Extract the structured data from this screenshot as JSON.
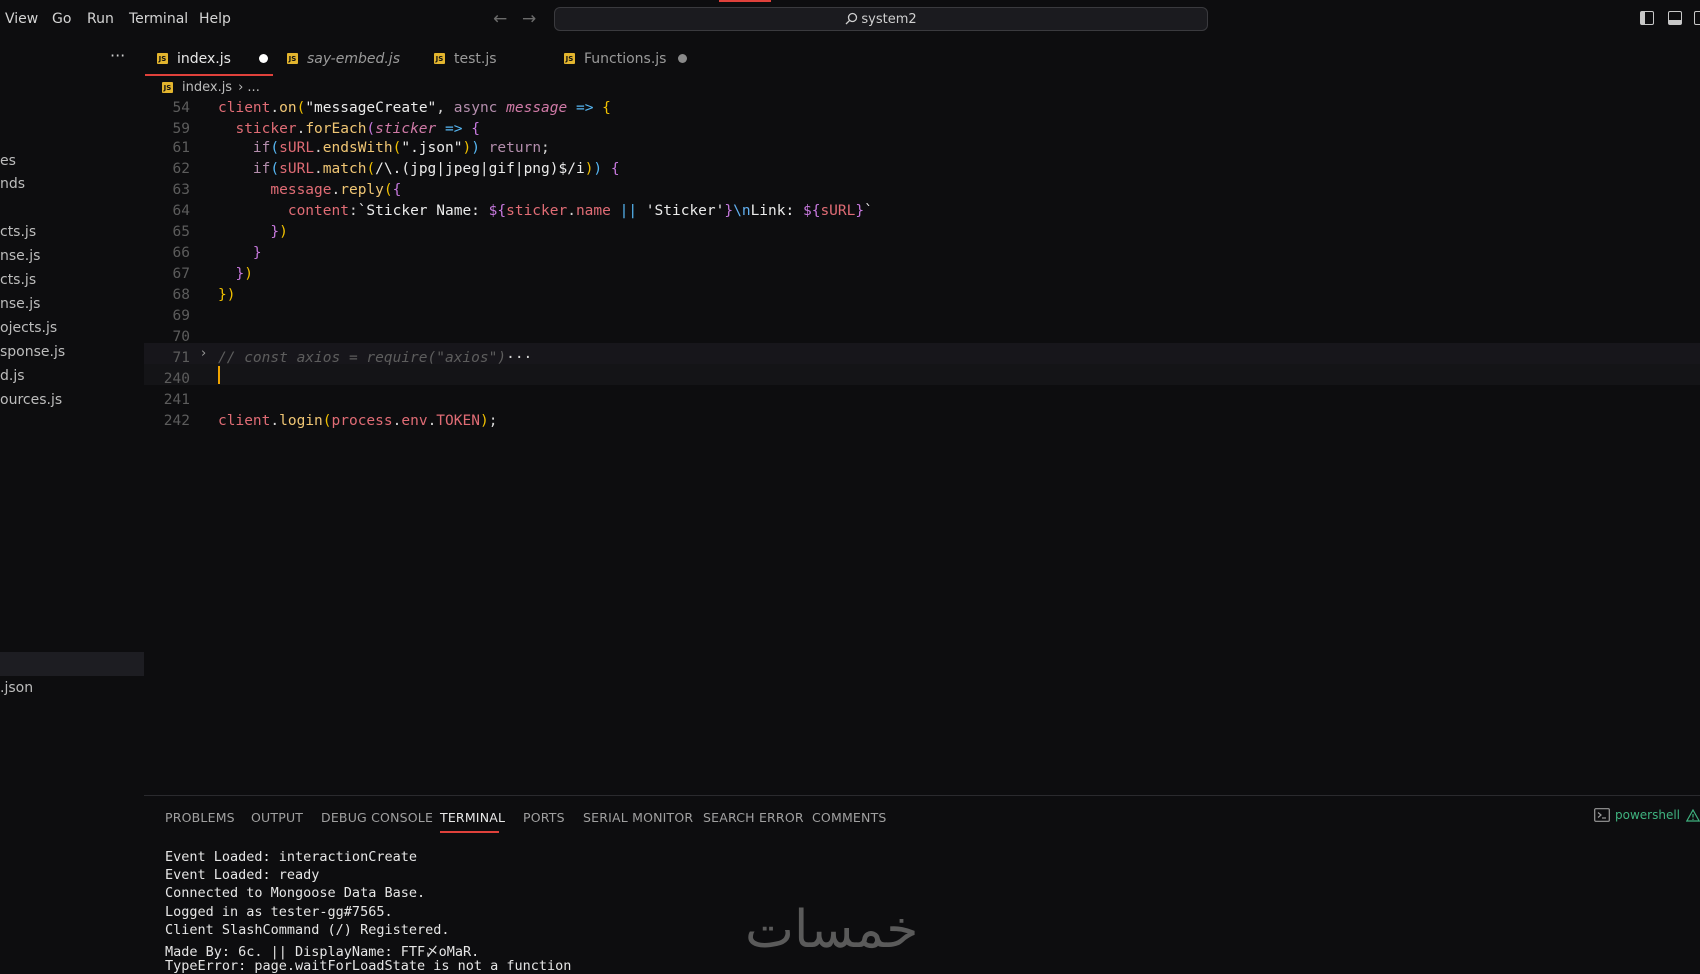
{
  "menu": [
    "View",
    "Go",
    "Run",
    "Terminal",
    "Help"
  ],
  "search": {
    "text": "system2"
  },
  "sidebar": {
    "files": [
      "es",
      "nds",
      "cts.js",
      "nse.js",
      "cts.js",
      "nse.js",
      "ojects.js",
      "sponse.js",
      "d.js",
      "ources.js",
      ".json"
    ]
  },
  "tabs": [
    {
      "label": "index.js"
    },
    {
      "label": "say-embed.js"
    },
    {
      "label": "test.js"
    },
    {
      "label": "Functions.js"
    }
  ],
  "breadcrumb": {
    "file": "index.js",
    "rest": "› ..."
  },
  "editor": {
    "lines": [
      {
        "n": "54",
        "segs": [
          [
            "k",
            "client"
          ],
          [
            "g",
            "."
          ],
          [
            "f",
            "on"
          ],
          [
            "y",
            "("
          ],
          [
            "s",
            "\"messageCreate\""
          ],
          [
            "g",
            ", "
          ],
          [
            "kw",
            "async "
          ],
          [
            "i",
            "message"
          ],
          [
            "b",
            " => "
          ],
          [
            "y",
            "{"
          ]
        ]
      },
      {
        "n": "59",
        "segs": [
          [
            "g",
            "  "
          ],
          [
            "k",
            "sticker"
          ],
          [
            "g",
            "."
          ],
          [
            "f",
            "forEach"
          ],
          [
            "m",
            "("
          ],
          [
            "i",
            "sticker"
          ],
          [
            "b",
            " => "
          ],
          [
            "m",
            "{"
          ]
        ]
      },
      {
        "n": "61",
        "segs": [
          [
            "g",
            "    "
          ],
          [
            "kw",
            "if"
          ],
          [
            "b",
            "("
          ],
          [
            "k",
            "sURL"
          ],
          [
            "g",
            "."
          ],
          [
            "f",
            "endsWith"
          ],
          [
            "y",
            "("
          ],
          [
            "s",
            "\".json\""
          ],
          [
            "y",
            ")"
          ],
          [
            "b",
            ")"
          ],
          [
            "kw",
            " return"
          ],
          [
            "g",
            ";"
          ]
        ]
      },
      {
        "n": "62",
        "segs": [
          [
            "g",
            "    "
          ],
          [
            "kw",
            "if"
          ],
          [
            "b",
            "("
          ],
          [
            "k",
            "sURL"
          ],
          [
            "g",
            "."
          ],
          [
            "f",
            "match"
          ],
          [
            "y",
            "("
          ],
          [
            "s",
            "/\\.(jpg|jpeg|gif|png)$/i"
          ],
          [
            "y",
            ")"
          ],
          [
            "b",
            ")"
          ],
          [
            "m",
            " {"
          ]
        ]
      },
      {
        "n": "63",
        "segs": [
          [
            "g",
            "      "
          ],
          [
            "k",
            "message"
          ],
          [
            "g",
            "."
          ],
          [
            "f",
            "reply"
          ],
          [
            "y",
            "("
          ],
          [
            "m",
            "{"
          ]
        ]
      },
      {
        "n": "64",
        "segs": [
          [
            "g",
            "        "
          ],
          [
            "k",
            "content"
          ],
          [
            "g",
            ":"
          ],
          [
            "s",
            "`Sticker Name: "
          ],
          [
            "m",
            "${"
          ],
          [
            "k",
            "sticker"
          ],
          [
            "g",
            "."
          ],
          [
            "k",
            "name"
          ],
          [
            "b",
            " || "
          ],
          [
            "s",
            "'Sticker'"
          ],
          [
            "m",
            "}"
          ],
          [
            "p",
            "\\n"
          ],
          [
            "s",
            "Link: "
          ],
          [
            "m",
            "${"
          ],
          [
            "k",
            "sURL"
          ],
          [
            "m",
            "}"
          ],
          [
            "s",
            "`"
          ]
        ]
      },
      {
        "n": "65",
        "segs": [
          [
            "g",
            "      "
          ],
          [
            "m",
            "}"
          ],
          [
            "y",
            ")"
          ]
        ]
      },
      {
        "n": "66",
        "segs": [
          [
            "g",
            "    "
          ],
          [
            "m",
            "}"
          ]
        ]
      },
      {
        "n": "67",
        "segs": [
          [
            "g",
            "  "
          ],
          [
            "m",
            "}"
          ],
          [
            "y",
            ")"
          ]
        ]
      },
      {
        "n": "68",
        "segs": [
          [
            "y",
            "}"
          ],
          [
            "y",
            ")"
          ]
        ]
      },
      {
        "n": "69",
        "segs": []
      },
      {
        "n": "70",
        "segs": []
      },
      {
        "n": "71",
        "segs": [
          [
            "c",
            "// const axios = require(\"axios\")"
          ],
          [
            "g",
            "···"
          ]
        ]
      },
      {
        "n": "240",
        "segs": []
      },
      {
        "n": "241",
        "segs": []
      },
      {
        "n": "242",
        "segs": [
          [
            "k",
            "client"
          ],
          [
            "g",
            "."
          ],
          [
            "f",
            "login"
          ],
          [
            "y",
            "("
          ],
          [
            "k",
            "process"
          ],
          [
            "g",
            "."
          ],
          [
            "k",
            "env"
          ],
          [
            "g",
            "."
          ],
          [
            "k",
            "TOKEN"
          ],
          [
            "y",
            ")"
          ],
          [
            "g",
            ";"
          ]
        ]
      }
    ]
  },
  "panel": {
    "tabs": [
      "PROBLEMS",
      "OUTPUT",
      "DEBUG CONSOLE",
      "TERMINAL",
      "PORTS",
      "SERIAL MONITOR",
      "SEARCH ERROR",
      "COMMENTS"
    ],
    "shell": "powershell",
    "terminal_lines": [
      "Event Loaded: interactionCreate",
      "Event Loaded: ready",
      "Connected to Mongoose Data Base.",
      "Logged in as tester-gg#7565.",
      "Client SlashCommand (/) Registered.",
      "Made By: 6c. || DisplayName: FTF〆oMaR.",
      "TypeError: page.waitForLoadState is not a function"
    ]
  },
  "watermark": "خمسات",
  "colors": {
    "accent": "#e0413b",
    "cursor": "#f0a400",
    "shell": "#3fb27f"
  }
}
